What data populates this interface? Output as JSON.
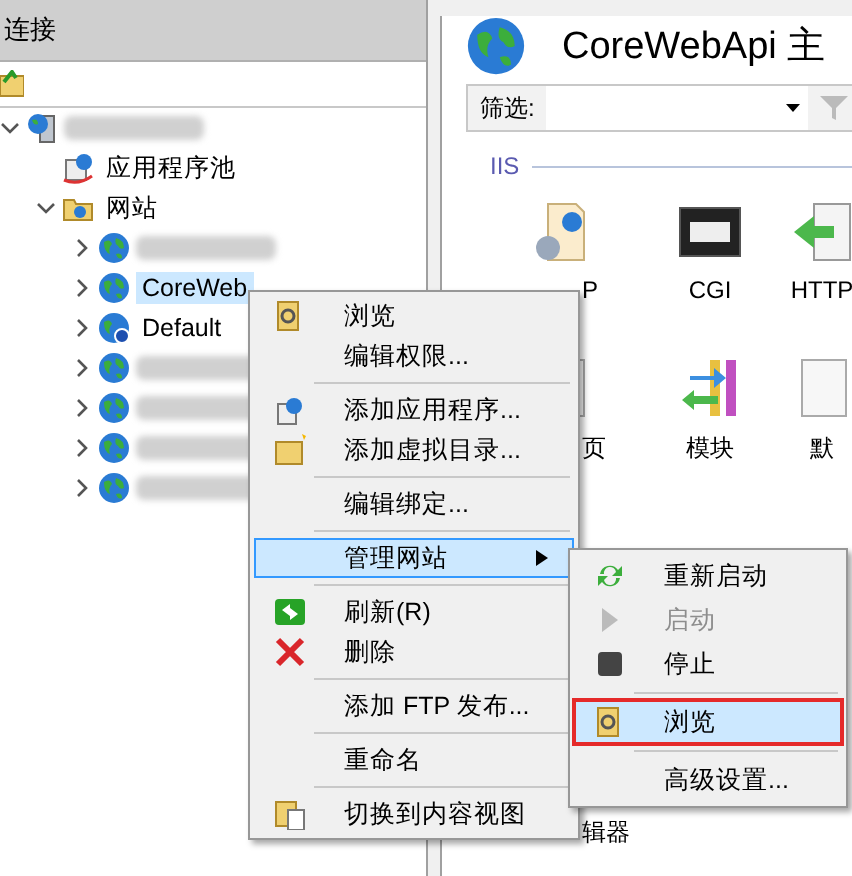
{
  "connections": {
    "title": "连接",
    "tree": [
      {
        "kind": "server",
        "expanded": true,
        "children": [
          {
            "label": "应用程序池",
            "kind": "pool"
          },
          {
            "label": "网站",
            "kind": "sites",
            "expanded": true,
            "children": [
              {
                "kind": "site",
                "selected": false
              },
              {
                "label": "CoreWeb",
                "kind": "site",
                "selected": true
              },
              {
                "label": "Default",
                "kind": "default",
                "selected": false
              },
              {
                "kind": "site",
                "selected": false
              },
              {
                "kind": "site",
                "selected": false
              },
              {
                "kind": "site",
                "selected": false
              },
              {
                "kind": "site",
                "selected": false
              }
            ]
          }
        ]
      }
    ]
  },
  "home": {
    "title": "CoreWebApi 主",
    "filter_label": "筛选:",
    "group": "IIS",
    "features": [
      {
        "label": "P",
        "kind": "doc"
      },
      {
        "label": "CGI",
        "kind": "cgi"
      },
      {
        "label": "HTTP",
        "kind": "http"
      },
      {
        "label": "页",
        "kind": "page"
      },
      {
        "label": "模块",
        "kind": "module"
      },
      {
        "label": "默",
        "kind": "page"
      },
      {
        "label": "辑器",
        "kind": "none"
      }
    ]
  },
  "context_menu": {
    "items": [
      {
        "kind": "item",
        "label": "浏览"
      },
      {
        "kind": "item",
        "label": "编辑权限..."
      },
      {
        "kind": "separator"
      },
      {
        "kind": "item",
        "label": "添加应用程序..."
      },
      {
        "kind": "item",
        "label": "添加虚拟目录..."
      },
      {
        "kind": "separator"
      },
      {
        "kind": "item",
        "label": "编辑绑定..."
      },
      {
        "kind": "separator"
      },
      {
        "kind": "submenu",
        "label": "管理网站",
        "selected": true
      },
      {
        "kind": "separator"
      },
      {
        "kind": "item",
        "label": "刷新(R)"
      },
      {
        "kind": "item",
        "label": "删除"
      },
      {
        "kind": "separator"
      },
      {
        "kind": "item",
        "label": "添加 FTP 发布..."
      },
      {
        "kind": "separator"
      },
      {
        "kind": "item",
        "label": "重命名"
      },
      {
        "kind": "separator"
      },
      {
        "kind": "item",
        "label": "切换到内容视图"
      }
    ]
  },
  "submenu": {
    "items": [
      {
        "kind": "item",
        "label": "重新启动",
        "disabled": false,
        "selected": false
      },
      {
        "kind": "item",
        "label": "启动",
        "disabled": true,
        "selected": false
      },
      {
        "kind": "item",
        "label": "停止",
        "disabled": false,
        "selected": false
      },
      {
        "kind": "separator"
      },
      {
        "kind": "item",
        "label": "浏览",
        "disabled": false,
        "selected": true
      },
      {
        "kind": "separator"
      },
      {
        "kind": "item",
        "label": "高级设置...",
        "disabled": false,
        "selected": false
      }
    ]
  }
}
